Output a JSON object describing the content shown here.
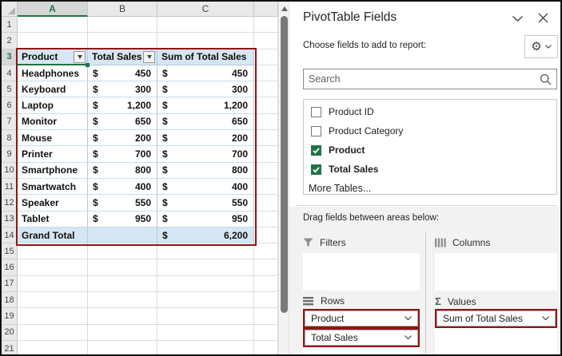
{
  "spreadsheet": {
    "column_headers": [
      "A",
      "B",
      "C"
    ],
    "row_numbers": [
      "1",
      "2",
      "3",
      "4",
      "5",
      "6",
      "7",
      "8",
      "9",
      "10",
      "11",
      "12",
      "13",
      "14",
      "15",
      "16",
      "17",
      "18",
      "19",
      "20",
      "21"
    ],
    "pivot_table": {
      "currency": "$",
      "columns": [
        "Product",
        "Total Sales",
        "Sum of Total Sales"
      ],
      "rows": [
        {
          "name": "Headphones",
          "value": "450"
        },
        {
          "name": "Keyboard",
          "value": "300"
        },
        {
          "name": "Laptop",
          "value": "1,200"
        },
        {
          "name": "Monitor",
          "value": "650"
        },
        {
          "name": "Mouse",
          "value": "200"
        },
        {
          "name": "Printer",
          "value": "700"
        },
        {
          "name": "Smartphone",
          "value": "800"
        },
        {
          "name": "Smartwatch",
          "value": "400"
        },
        {
          "name": "Speaker",
          "value": "550"
        },
        {
          "name": "Tablet",
          "value": "950"
        }
      ],
      "grand_total": {
        "label": "Grand Total",
        "value": "6,200"
      }
    }
  },
  "panel": {
    "title": "PivotTable Fields",
    "choose_fields_label": "Choose fields to add to report:",
    "search_placeholder": "Search",
    "field_list": [
      {
        "label": "Product ID",
        "checked": false
      },
      {
        "label": "Product Category",
        "checked": false
      },
      {
        "label": "Product",
        "checked": true
      },
      {
        "label": "Total Sales",
        "checked": true
      }
    ],
    "more_tables_label": "More Tables...",
    "drag_label": "Drag fields between areas below:",
    "areas": {
      "filters": {
        "label": "Filters",
        "items": []
      },
      "columns": {
        "label": "Columns",
        "items": []
      },
      "rows": {
        "label": "Rows",
        "items": [
          "Product",
          "Total Sales"
        ]
      },
      "values": {
        "label": "Values",
        "items": [
          "Sum of Total Sales"
        ]
      }
    }
  },
  "colors": {
    "annotation_red": "#8f1713",
    "pivot_header_blue": "#d6e6f2",
    "excel_green": "#217346"
  }
}
